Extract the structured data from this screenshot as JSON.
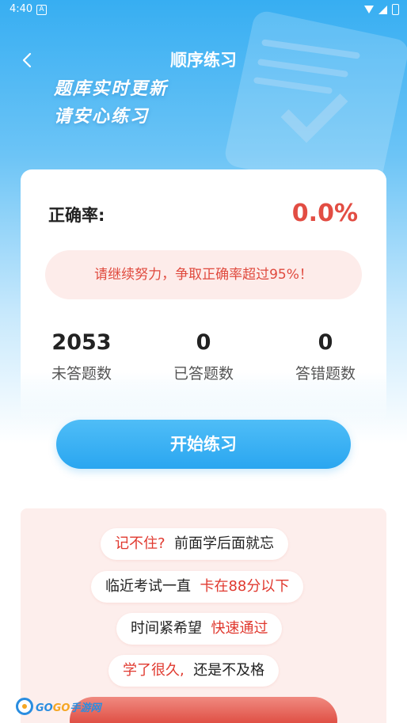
{
  "status_bar": {
    "time": "4:40",
    "notification_glyph": "A"
  },
  "header": {
    "title": "顺序练习",
    "back_icon": "chevron-left-icon",
    "slogan_line1": "题库实时更新",
    "slogan_line2": "请安心练习"
  },
  "stats": {
    "accuracy_label": "正确率:",
    "accuracy_value": "0.0%",
    "encouragement": "请继续努力，争取正确率超过95%！",
    "items": [
      {
        "number": "2053",
        "label": "未答题数"
      },
      {
        "number": "0",
        "label": "已答题数"
      },
      {
        "number": "0",
        "label": "答错题数"
      }
    ]
  },
  "start_button": {
    "label": "开始练习"
  },
  "pain_points": [
    {
      "highlight": "记不住?",
      "text": "前面学后面就忘"
    },
    {
      "text": "临近考试一直",
      "highlight": "卡在88分以下"
    },
    {
      "text": "时间紧希望",
      "highlight": "快速通过"
    },
    {
      "highlight": "学了很久,",
      "text": "还是不及格"
    }
  ],
  "watermark": {
    "brand_a": "GO",
    "brand_b": "GO",
    "suffix": "手游网"
  },
  "colors": {
    "primary_blue": "#2aa6f0",
    "accent_red": "#e24d43",
    "pink_bg": "#fdeeec"
  }
}
